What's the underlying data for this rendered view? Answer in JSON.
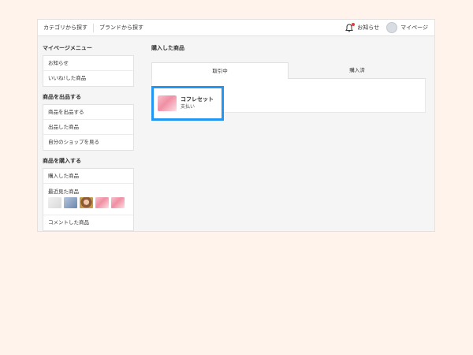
{
  "header": {
    "nav": [
      "カテゴリから探す",
      "ブランドから探す"
    ],
    "notifications_label": "お知らせ",
    "mypage_label": "マイページ"
  },
  "sidebar": {
    "menu_title": "マイページメニュー",
    "menu_items": [
      "お知らせ",
      "いいね!した商品"
    ],
    "sell_title": "商品を出品する",
    "sell_items": [
      "商品を出品する",
      "出品した商品",
      "自分のショップを見る"
    ],
    "buy_title": "商品を購入する",
    "buy_items": {
      "purchased": "購入した商品",
      "recent": "最近見た商品",
      "commented": "コメントした商品"
    },
    "recent_thumbs": [
      "bag-thumbnail",
      "clothing-thumbnail",
      "portrait-thumbnail",
      "pink-set-thumbnail",
      "pink-set-thumbnail"
    ]
  },
  "main": {
    "title": "購入した商品",
    "tabs": [
      "取引中",
      "購入済"
    ],
    "active_tab": "取引中",
    "item": {
      "name": "コフレセット",
      "status": "支払い"
    }
  },
  "colors": {
    "page_background": "#fff3ec",
    "highlight_border": "#2196f3",
    "notification_dot": "#e53935"
  }
}
